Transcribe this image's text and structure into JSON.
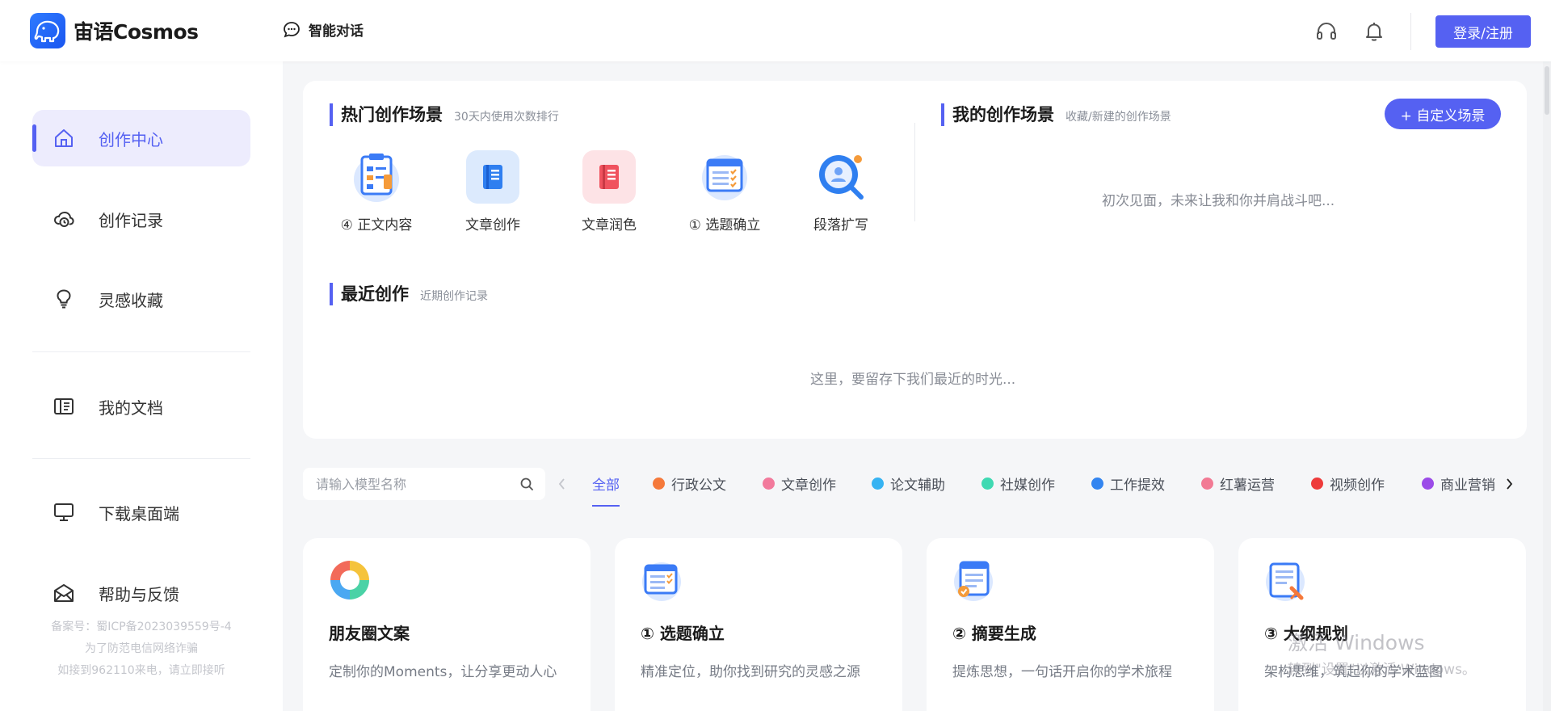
{
  "header": {
    "app_name": "宙语Cosmos",
    "chat_nav": "智能对话",
    "login_label": "登录/注册",
    "icons": [
      "headset-icon",
      "bell-icon"
    ]
  },
  "sidebar": {
    "items": [
      {
        "label": "创作中心",
        "icon": "home-icon",
        "active": true
      },
      {
        "label": "创作记录",
        "icon": "cloud-history-icon"
      },
      {
        "label": "灵感收藏",
        "icon": "lightbulb-icon"
      },
      {
        "label": "我的文档",
        "icon": "document-icon"
      },
      {
        "label": "下载桌面端",
        "icon": "monitor-icon"
      },
      {
        "label": "帮助与反馈",
        "icon": "mail-icon"
      }
    ],
    "footer": {
      "line1": "备案号：蜀ICP备2023039559号-4",
      "line2": "为了防范电信网络诈骗",
      "line3": "如接到962110来电，请立即接听"
    }
  },
  "hot": {
    "title": "热门创作场景",
    "subtitle": "30天内使用次数排行",
    "scenes": [
      {
        "label": "④ 正文内容",
        "icon": "clipboard-icon"
      },
      {
        "label": "文章创作",
        "icon": "book-icon"
      },
      {
        "label": "文章润色",
        "icon": "notebook-icon"
      },
      {
        "label": "① 选题确立",
        "icon": "checklist-icon"
      },
      {
        "label": "段落扩写",
        "icon": "magnifier-user-icon"
      }
    ]
  },
  "mine": {
    "title": "我的创作场景",
    "subtitle": "收藏/新建的创作场景",
    "custom_label": "+ 自定义场景",
    "empty": "初次见面，未来让我和你并肩战斗吧..."
  },
  "recent": {
    "title": "最近创作",
    "subtitle": "近期创作记录",
    "empty": "这里，要留存下我们最近的时光..."
  },
  "filter": {
    "search_placeholder": "请输入模型名称",
    "categories": [
      {
        "label": "全部",
        "active": true
      },
      {
        "label": "行政公文",
        "color": "#f5793b"
      },
      {
        "label": "文章创作",
        "color": "#f27a9c"
      },
      {
        "label": "论文辅助",
        "color": "#36b3f2"
      },
      {
        "label": "社媒创作",
        "color": "#3fd9b2"
      },
      {
        "label": "工作提效",
        "color": "#3385f0"
      },
      {
        "label": "红薯运营",
        "color": "#f27a94"
      },
      {
        "label": "视频创作",
        "color": "#ee3b3b"
      },
      {
        "label": "商业营销",
        "color": "#9b4be8"
      }
    ]
  },
  "cards": [
    {
      "title": "朋友圈文案",
      "desc": "定制你的Moments，让分享更动人心",
      "icon": "color-wheel-icon"
    },
    {
      "title": "① 选题确立",
      "desc": "精准定位，助你找到研究的灵感之源",
      "icon": "checklist-icon"
    },
    {
      "title": "② 摘要生成",
      "desc": "提炼思想，一句话开启你的学术旅程",
      "icon": "scroll-icon"
    },
    {
      "title": "③ 大纲规划",
      "desc": "架构思维，筑起你的学术蓝图",
      "icon": "outline-pen-icon"
    }
  ],
  "watermark": {
    "line1": "激活 Windows",
    "line2": "转到\"设置\"以激活 Windows。"
  }
}
